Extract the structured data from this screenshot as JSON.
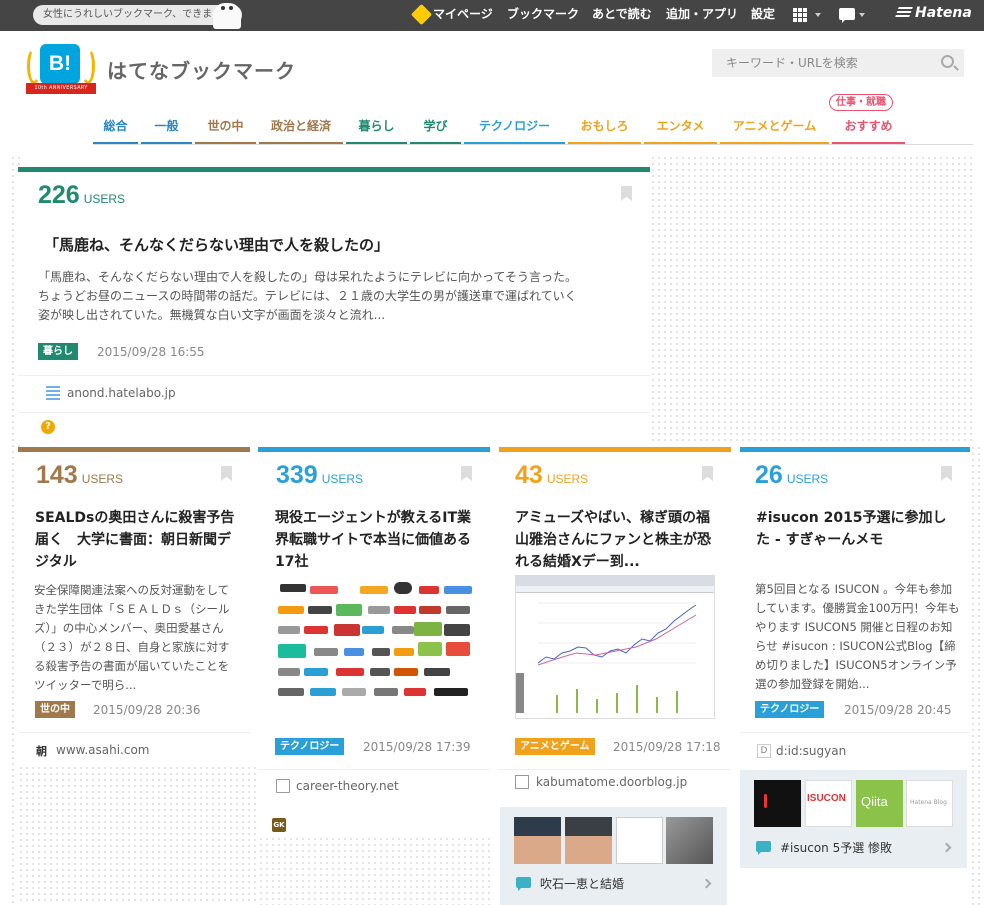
{
  "topbar": {
    "promo": "女性にうれしいブックマーク、できました",
    "nav": [
      "マイページ",
      "ブックマーク",
      "あとで読む",
      "追加・アプリ",
      "設定"
    ],
    "brand": "Hatena"
  },
  "header": {
    "logo_text": "B!",
    "anniversary": "10th ANNIVERSARY",
    "site_title": "はてなブックマーク",
    "search_placeholder": "キーワード・URLを検索"
  },
  "categories": [
    {
      "label": "総合",
      "color": "#2b86c5"
    },
    {
      "label": "一般",
      "color": "#2b86c5"
    },
    {
      "label": "世の中",
      "color": "#a0784b"
    },
    {
      "label": "政治と経済",
      "color": "#a0784b"
    },
    {
      "label": "暮らし",
      "color": "#1f8a6f"
    },
    {
      "label": "学び",
      "color": "#1f8a6f"
    },
    {
      "label": "テクノロジー",
      "color": "#2aa0d8"
    },
    {
      "label": "おもしろ",
      "color": "#f0a21c"
    },
    {
      "label": "エンタメ",
      "color": "#f0a21c"
    },
    {
      "label": "アニメとゲーム",
      "color": "#f0a21c"
    },
    {
      "label": "おすすめ",
      "color": "#e8546f"
    }
  ],
  "recommend_badge": "仕事・就職",
  "entries": {
    "featured": {
      "count": "226",
      "users": "USERS",
      "color": "#1f8a6f",
      "title": "「馬鹿ね、そんなくだらない理由で人を殺したの」",
      "desc": "「馬鹿ね、そんなくだらない理由で人を殺したの」母は呆れたようにテレビに向かってそう言った。ちょうどお昼のニュースの時間帯の話だ。テレビには、２１歳の大学生の男が護送車で運ばれていく姿が映し出されていた。無機質な白い文字が画面を淡々と流れ...",
      "tag": "暮らし",
      "date": "2015/09/28 16:55",
      "source": "anond.hatelabo.jp"
    },
    "e1": {
      "count": "143",
      "users": "USERS",
      "color": "#a0784b",
      "title": "SEALDsの奥田さんに殺害予告届く　大学に書面：朝日新聞デジタル",
      "desc": "安全保障関連法案への反対運動をしてきた学生団体「ＳＥＡＬＤｓ（シールズ）」の中心メンバー、奥田愛基さん（２３）が２８日、自身と家族に対する殺害予告の書面が届いていたことをツイッターで明ら...",
      "tag": "世の中",
      "date": "2015/09/28 20:36",
      "source": "www.asahi.com",
      "favicon": "朝"
    },
    "e2": {
      "count": "339",
      "users": "USERS",
      "color": "#2aa0d8",
      "title": "現役エージェントが教えるIT業界転職サイトで本当に価値ある17社",
      "tag": "テクノロジー",
      "date": "2015/09/28 17:39",
      "source": "career-theory.net",
      "favicon": "GK"
    },
    "e3": {
      "count": "43",
      "users": "USERS",
      "color": "#f0a21c",
      "title": "アミューズやばい、稼ぎ頭の福山雅治さんにファンと株主が恐れる結婚Xデー到...",
      "tag": "アニメとゲーム",
      "date": "2015/09/28 17:18",
      "source": "kabumatome.doorblog.jp",
      "related": "吹石一恵と結婚"
    },
    "e4": {
      "count": "26",
      "users": "USERS",
      "color": "#2aa0d8",
      "title": "#isucon 2015予選に参加した - すぎゃーんメモ",
      "desc": "第5回目となる ISUCON 。今年も参加しています。優勝賞金100万円！今年もやります ISUCON5 開催と日程のお知らせ #isucon : ISUCON公式Blog【締め切りました】ISUCON5オンライン予選の参加登録を開始...",
      "tag": "テクノロジー",
      "date": "2015/09/28 20:45",
      "source": "d:id:sugyan",
      "favicon": "D",
      "related": "#isucon 5予選 惨敗",
      "thumb_texts": [
        "ISUCON",
        "Qiita",
        "Hatena Blog"
      ]
    }
  }
}
